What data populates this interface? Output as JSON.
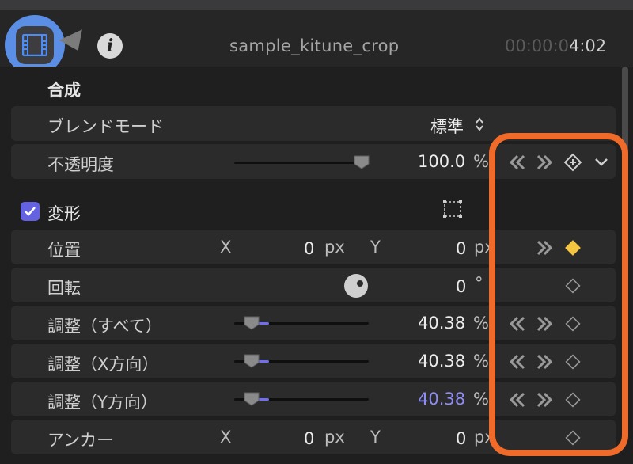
{
  "header": {
    "clip_name": "sample_kitune_crop",
    "timecode_dim": "00:00:0",
    "timecode_lit": "4:02",
    "info_label": "i"
  },
  "icons": {
    "film": "film-icon",
    "filter": "filter-tab-icon",
    "info": "info-icon",
    "transform_overlay": "transform-overlay-icon",
    "kf_prev": "keyframe-prev-icon",
    "kf_next": "keyframe-next-icon",
    "kf_add": "keyframe-add-icon",
    "kf_diamond": "keyframe-diamond-icon",
    "chevron": "chevron-down-icon"
  },
  "colors": {
    "accent": "#6462e0",
    "highlight_circle": "#5b8fe6",
    "annotation_box": "#f06a2a",
    "keyframe_active": "#f5c542"
  },
  "compositing": {
    "title": "合成",
    "blend_mode": {
      "label": "ブレンドモード",
      "value": "標準",
      "control": "⌃⌄"
    },
    "opacity": {
      "label": "不透明度",
      "value": "100.0",
      "unit": "%",
      "level": 1.0
    }
  },
  "transform": {
    "title": "変形",
    "checked": true,
    "position": {
      "label": "位置",
      "x_label": "X",
      "x_value": "0",
      "x_unit": "px",
      "y_label": "Y",
      "y_value": "0",
      "y_unit": "px"
    },
    "rotation": {
      "label": "回転",
      "value": "0",
      "unit": "°"
    },
    "scale_all": {
      "label": "調整（すべて）",
      "value": "40.38",
      "unit": "%"
    },
    "scale_x": {
      "label": "調整（X方向）",
      "value": "40.38",
      "unit": "%"
    },
    "scale_y": {
      "label": "調整（Y方向）",
      "value": "40.38",
      "unit": "%"
    },
    "anchor": {
      "label": "アンカー",
      "x_label": "X",
      "x_value": "0",
      "x_unit": "px",
      "y_label": "Y",
      "y_value": "0",
      "y_unit": "px"
    }
  }
}
